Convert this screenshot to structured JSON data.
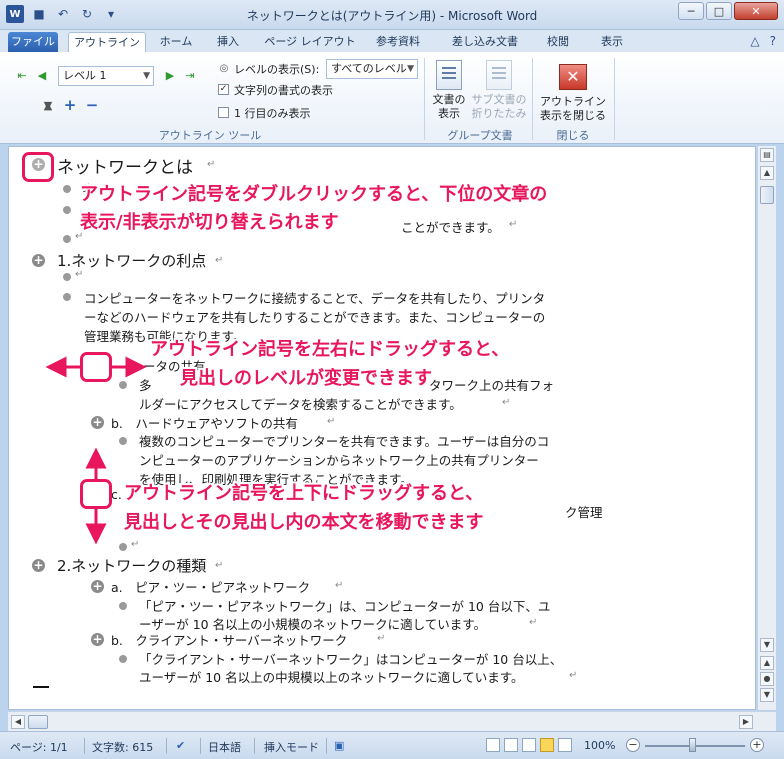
{
  "window": {
    "title": "ネットワークとは(アウトライン用)  -  Microsoft Word",
    "minimize": "─",
    "maximize": "□",
    "close": "✕"
  },
  "qat": {
    "word_icon": "W",
    "save_glyph": "■",
    "undo_glyph": "↶",
    "redo_glyph": "↻",
    "customize_glyph": "▾"
  },
  "tabs": [
    "ファイル",
    "アウトライン",
    "ホーム",
    "挿入",
    "ページ レイアウト",
    "参考資料",
    "差し込み文書",
    "校閲",
    "表示"
  ],
  "tab_right": {
    "help": "?",
    "collapse": "△"
  },
  "ribbon": {
    "outline_tools": {
      "level_value": "レベル 1",
      "show_level_label": "レベルの表示(S):",
      "show_level_value": "すべてのレベル",
      "show_text_formatting": "文字列の書式の表示",
      "show_text_formatting_checked": true,
      "show_first_line_only": "1 行目のみ表示",
      "show_first_line_only_checked": false,
      "group_label": "アウトライン ツール"
    },
    "master_document": {
      "show_document": [
        "文書の",
        "表示"
      ],
      "collapse_subdocuments": [
        "サブ文書の",
        "折りたたみ"
      ],
      "group_label": "グループ文書"
    },
    "close": {
      "close_outline": [
        "アウトライン",
        "表示を閉じる"
      ],
      "group_label": "閉じる"
    }
  },
  "document": {
    "heading1": "ネットワークとは",
    "frag1": "ネ",
    "frag1b": "ト",
    "frag1c": "ンピュ",
    "frag1d": "を接続したもので、",
    "frag1e": "てネ",
    "frag1f": "ワ",
    "frag1g": "ク上の文書をま",
    "frag2": "コンピュ",
    "frag2b": "ことができます。",
    "section1": "1.ネットワークの利点",
    "para1": [
      "コンピューターをネットワークに接続することで、データを共有したり、プリンタ",
      "ーなどのハードウェアを共有したりすることができます。また、コンピューターの",
      "管理業務も可能になります。"
    ],
    "sub_a_frag": "デ",
    "sub_a_frag2": "ータの共有",
    "para_a": [
      "多",
      "タワーク上の共有フォ",
      "ルダーにアクセスしてデータを検索することができます。"
    ],
    "sub_b": "b.　ハードウェアやソフトの共有",
    "para_b": [
      "複数のコンピューターでプリンターを共有できます。ユーザーは自分のコ",
      "ンピューターのアプリケーションからネットワーク上の共有プリンター",
      "を使用し、印刷処理を実行することができます。"
    ],
    "sub_c_frag": "c.",
    "para_c_frag": "ク管理",
    "section2": "2.ネットワークの種類",
    "sub2_a": "a.　ピア・ツー・ピアネットワーク",
    "para2_a": [
      "「ピア・ツー・ピアネットワーク」は、コンピューターが 10 台以下、ユ",
      "ーザーが 10 名以上の小規模のネットワークに適しています。"
    ],
    "sub2_b": "b.　クライアント・サーバーネットワーク",
    "para2_b": [
      "「クライアント・サーバーネットワーク」はコンピューターが 10 台以上、",
      "ユーザーが 10 名以上の中規模以上のネットワークに適しています。"
    ],
    "paragraph_mark": "↵"
  },
  "annotations": {
    "callout1": [
      "アウトライン記号をダブルクリックすると、下位の文章の",
      "表示/非表示が切り替えられます"
    ],
    "callout2": [
      "アウトライン記号を左右にドラッグすると、",
      "見出しのレベルが変更できます"
    ],
    "callout3": [
      "アウトライン記号を上下にドラッグすると、",
      "見出しとその見出し内の本文を移動できます"
    ],
    "accent": "#e8175d"
  },
  "statusbar": {
    "page": "ページ: 1/1",
    "word_count": "文字数: 615",
    "language": "日本語",
    "mode": "挿入モード",
    "zoom": "100%",
    "zoom_minus": "−",
    "zoom_plus": "+"
  }
}
